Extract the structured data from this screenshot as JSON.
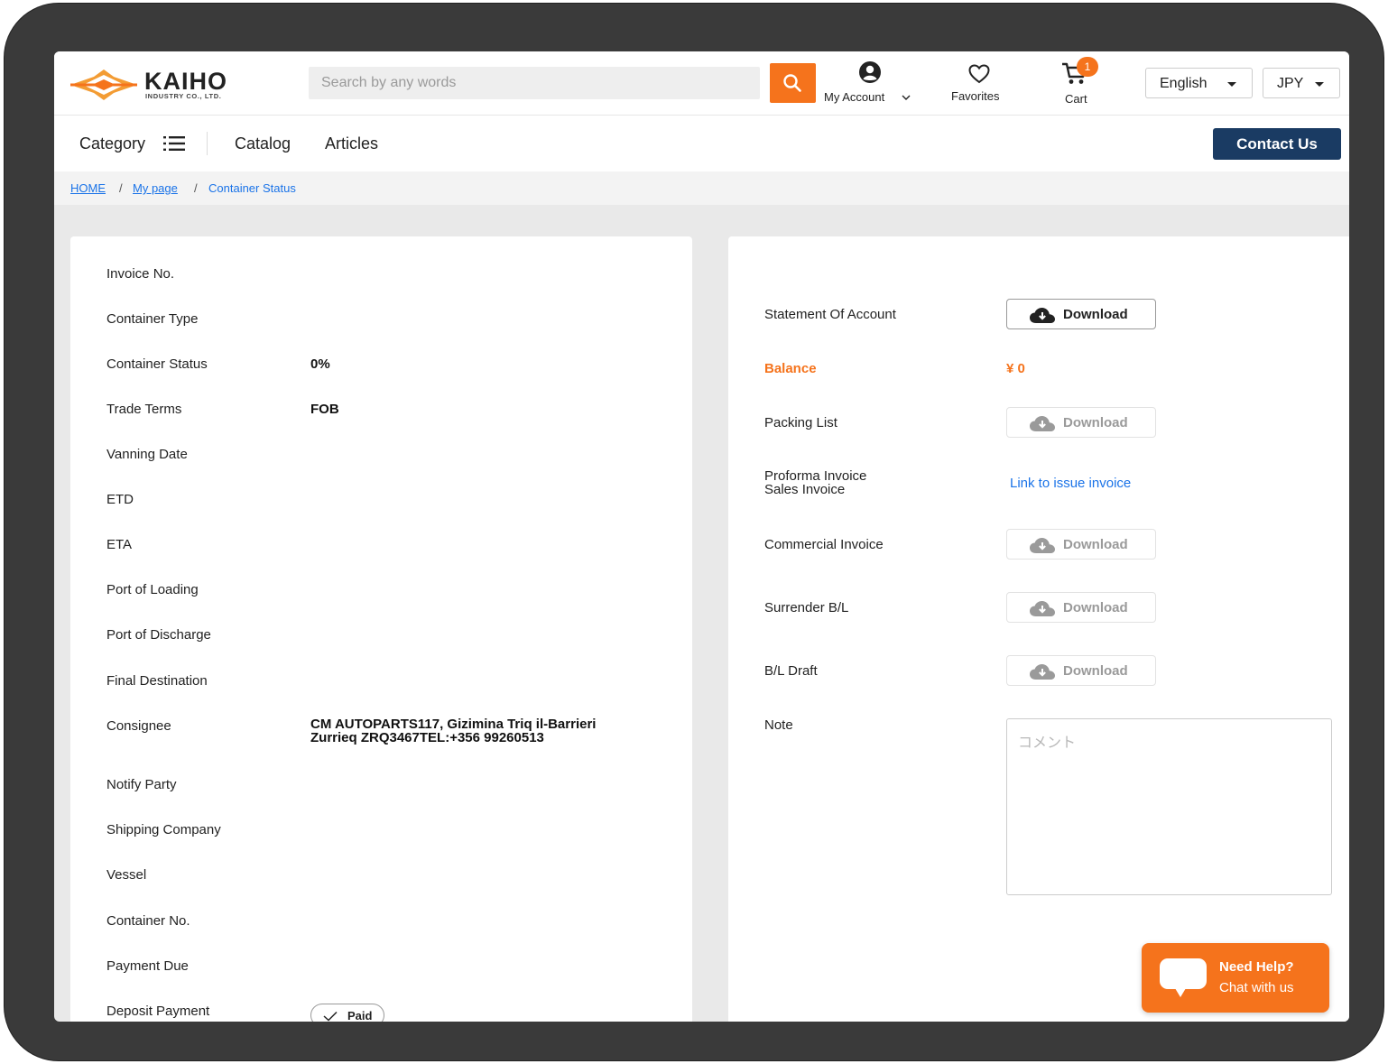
{
  "brand": {
    "name": "KAIHO",
    "sub": "INDUSTRY CO., LTD.",
    "accent": "#f5731c",
    "navy": "#1a3b63"
  },
  "header": {
    "search_placeholder": "Search by any words",
    "my_account": "My Account",
    "favorites": "Favorites",
    "cart": "Cart",
    "cart_count": "1",
    "language": "English",
    "currency": "JPY"
  },
  "nav": {
    "category": "Category",
    "catalog": "Catalog",
    "articles": "Articles",
    "contact": "Contact Us"
  },
  "breadcrumb": {
    "home": "HOME",
    "mypage": "My page",
    "current": "Container Status",
    "sep": "/"
  },
  "details": {
    "invoice_no": "Invoice No.",
    "container_type": "Container Type",
    "container_status": "Container Status",
    "container_status_value": "0%",
    "trade_terms": "Trade Terms",
    "trade_terms_value": "FOB",
    "vanning_date": "Vanning Date",
    "etd": "ETD",
    "eta": "ETA",
    "port_loading": "Port of Loading",
    "port_discharge": "Port of Discharge",
    "final_destination": "Final Destination",
    "consignee": "Consignee",
    "consignee_line1": "CM AUTOPARTS117, Gizimina Triq il-Barrieri",
    "consignee_line2": "Zurrieq ZRQ3467TEL:+356 99260513",
    "notify_party": "Notify Party",
    "shipping_company": "Shipping Company",
    "vessel": "Vessel",
    "container_no": "Container No.",
    "payment_due": "Payment Due",
    "deposit_payment": "Deposit Payment",
    "deposit_status": "Paid"
  },
  "documents": {
    "statement": "Statement Of Account",
    "balance": "Balance",
    "balance_value": "¥ 0",
    "packing_list": "Packing List",
    "proforma": "Proforma Invoice",
    "sales_invoice": "Sales Invoice",
    "issue_link": "Link to issue invoice",
    "commercial": "Commercial Invoice",
    "surrender": "Surrender B/L",
    "bl_draft": "B/L Draft",
    "note": "Note",
    "note_placeholder": "コメント",
    "download": "Download"
  },
  "chat": {
    "title": "Need Help?",
    "subtitle": "Chat with us"
  }
}
